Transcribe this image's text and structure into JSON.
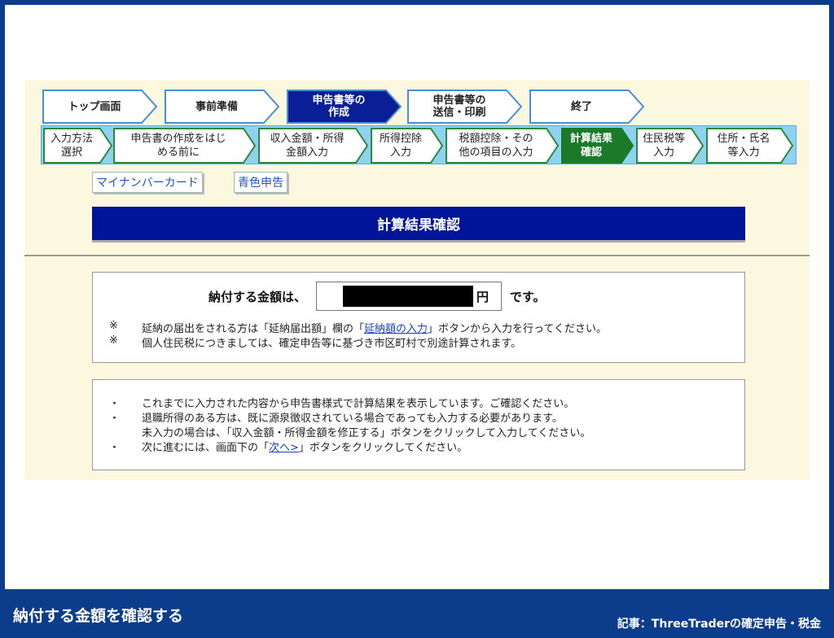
{
  "top_steps": [
    {
      "label": "トップ画面"
    },
    {
      "label": "事前準備"
    },
    {
      "label": "申告書等の\n作成"
    },
    {
      "label": "申告書等の\n送信・印刷"
    },
    {
      "label": "終了"
    }
  ],
  "sub_steps": [
    {
      "label": "入力方法\n選択"
    },
    {
      "label": "申告書の作成をはじ\nめる前に"
    },
    {
      "label": "収入金額・所得\n金額入力"
    },
    {
      "label": "所得控除\n入力"
    },
    {
      "label": "税額控除・その\n他の項目の入力"
    },
    {
      "label": "計算結果\n確認"
    },
    {
      "label": "住民税等\n入力"
    },
    {
      "label": "住所・氏名\n等入力"
    }
  ],
  "links": {
    "mynumber": "マイナンバーカード",
    "blue": "青色申告"
  },
  "title": "計算結果確認",
  "amount": {
    "prefix": "納付する金額は、",
    "unit": "円",
    "suffix": "です。"
  },
  "notes": [
    {
      "mark": "※",
      "pre": "延納の届出をされる方は「延納届出額」欄の「",
      "link": "延納額の入力",
      "post": "」ボタンから入力を行ってください。"
    },
    {
      "mark": "※",
      "text": "個人住民税につきましては、確定申告等に基づき市区町村で別途計算されます。"
    }
  ],
  "bullets": [
    {
      "dot": "・",
      "text": "これまでに入力された内容から申告書様式で計算結果を表示しています。ご確認ください。"
    },
    {
      "dot": "・",
      "text": "退職所得のある方は、既に源泉徴収されている場合であっても入力する必要があります。"
    },
    {
      "dot": "",
      "text": "未入力の場合は、「収入金額・所得金額を修正する」ボタンをクリックして入力してください。"
    },
    {
      "dot": "・",
      "pre": "次に進むには、画面下の「",
      "link": "次へ>",
      "post": "」ボタンをクリックしてください。"
    }
  ],
  "footer": {
    "left": "納付する金額を確認する",
    "right": "記事：ThreeTraderの確定申告・税金"
  }
}
